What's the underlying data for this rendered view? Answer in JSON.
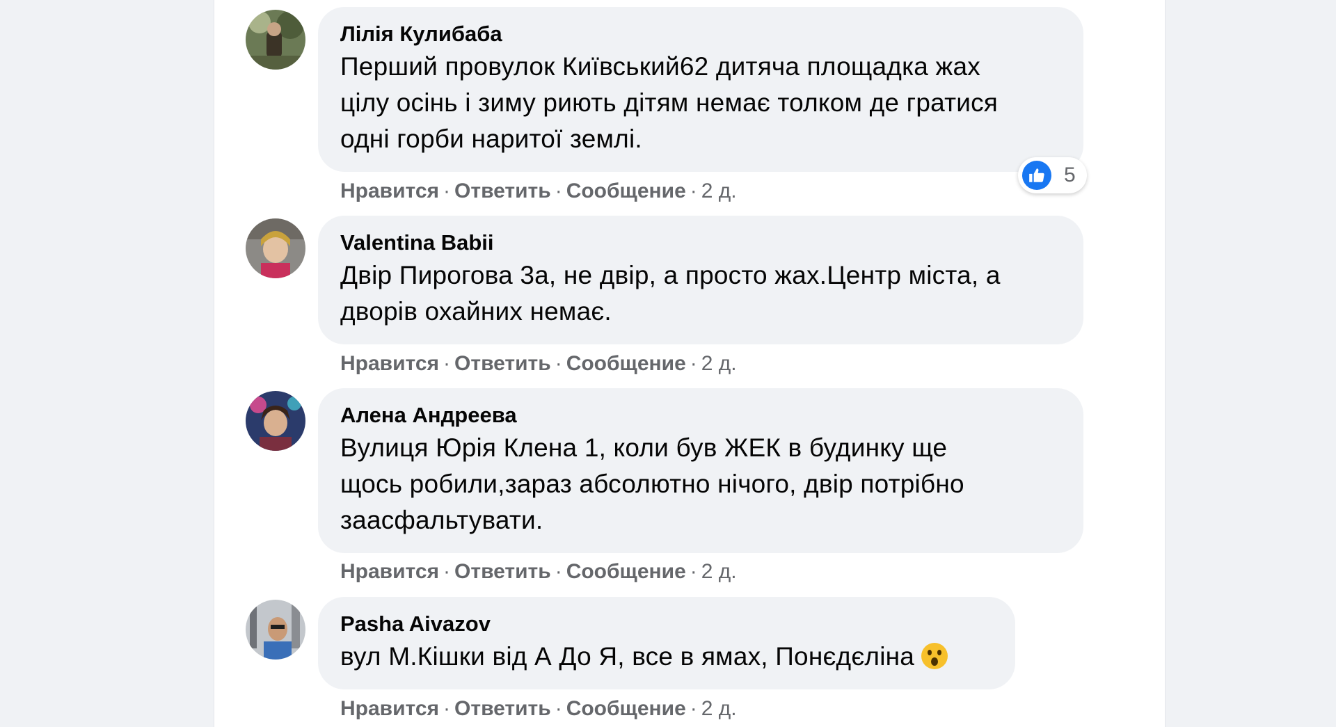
{
  "comments": [
    {
      "author": "Лілія Кулибаба",
      "lines": [
        "Перший провулок Київський62 дитяча площадка жах",
        "цілу осінь і зиму риють дітям немає толком де гратися",
        "одні горби наритої землі."
      ],
      "reaction_count": "5",
      "actions": {
        "like": "Нравится",
        "reply": "Ответить",
        "message": "Сообщение",
        "time": "2 д."
      }
    },
    {
      "author": "Valentina Babii",
      "lines": [
        "Двір Пирогова 3а, не двір, а просто жах.Центр міста, а",
        "дворів охайних немає."
      ],
      "actions": {
        "like": "Нравится",
        "reply": "Ответить",
        "message": "Сообщение",
        "time": "2 д."
      }
    },
    {
      "author": "Алена Андреева",
      "lines": [
        "Вулиця Юрія Клена 1, коли був ЖЕК в будинку ще",
        "щось робили,зараз абсолютно нічого, двір потрібно",
        "заасфальтувати."
      ],
      "actions": {
        "like": "Нравится",
        "reply": "Ответить",
        "message": "Сообщение",
        "time": "2 д."
      }
    },
    {
      "author": "Pasha Aivazov",
      "lines": [
        "вул М.Кішки від А До Я, все в ямах, Понєдєліна"
      ],
      "emoji": "astonished-face-icon",
      "actions": {
        "like": "Нравится",
        "reply": "Ответить",
        "message": "Сообщение",
        "time": "2 д."
      }
    }
  ],
  "separator": "·",
  "colors": {
    "page_bg": "#f0f2f5",
    "bubble_bg": "#f0f2f5",
    "text": "#050505",
    "meta": "#65676b",
    "like_blue": "#1877f2"
  }
}
